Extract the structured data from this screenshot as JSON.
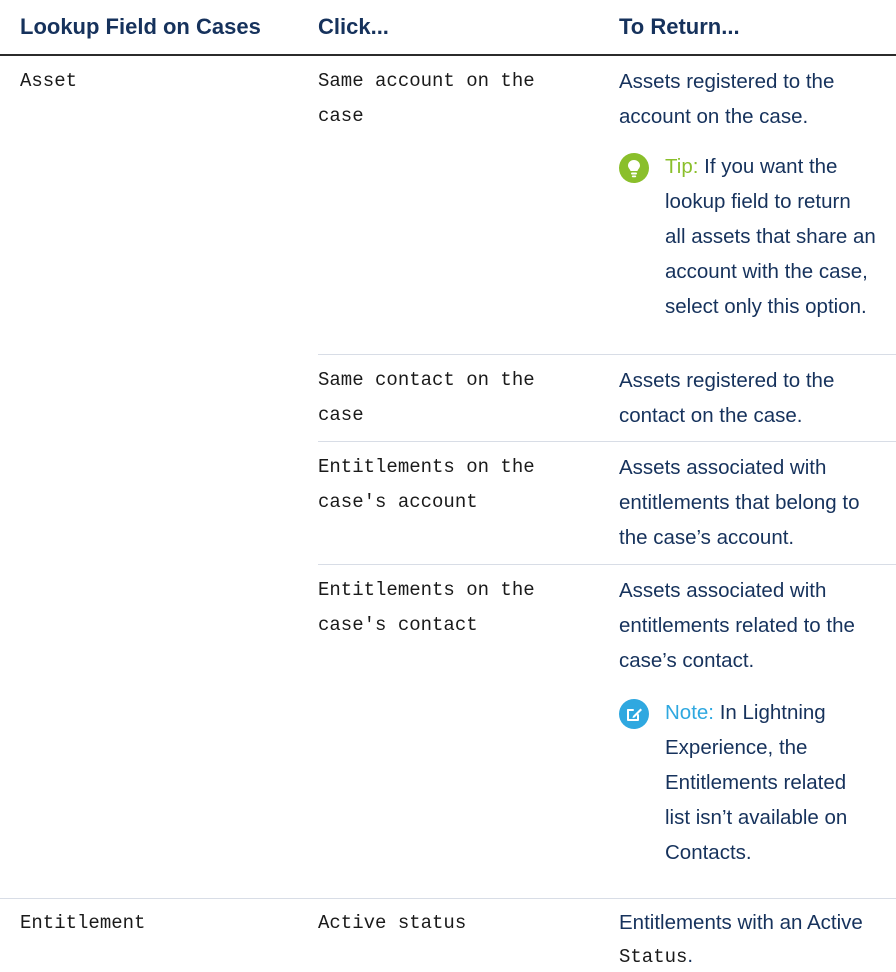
{
  "table": {
    "headers": {
      "lookup_field": "Lookup Field on Cases",
      "click": "Click...",
      "to_return": "To Return..."
    },
    "rows": [
      {
        "field": "Asset",
        "click": [
          "Same account on the",
          "case"
        ],
        "return": [
          "Assets registered to the",
          "account on the case."
        ],
        "tip": {
          "label": "Tip:",
          "lines": [
            "If you want the",
            "lookup field to return",
            "all assets that share an",
            "account with the case,",
            "select only this option."
          ]
        }
      },
      {
        "click": [
          "Same contact on the",
          "case"
        ],
        "return": [
          "Assets registered to the",
          "contact on the case."
        ]
      },
      {
        "click": [
          "Entitlements on the",
          "case's account"
        ],
        "return": [
          "Assets associated with",
          "entitlements that belong to",
          "the case’s account."
        ]
      },
      {
        "click": [
          "Entitlements on the",
          "case's contact"
        ],
        "return": [
          "Assets associated with",
          "entitlements related to the",
          "case’s contact."
        ],
        "note": {
          "label": "Note:",
          "lines": [
            "In Lightning",
            "Experience, the",
            "Entitlements related",
            "list isn’t available on",
            "Contacts."
          ]
        }
      },
      {
        "field": "Entitlement",
        "click": [
          "Active status"
        ],
        "return": [
          "Entitlements with an Active"
        ],
        "return_code": "Status",
        "return_tail": "."
      }
    ]
  },
  "colors": {
    "header_text": "#16325c",
    "tip_accent": "#8abf2b",
    "note_accent": "#2fa8e0",
    "divider": "#d8dde6"
  },
  "icons": {
    "tip": "lightbulb-icon",
    "note": "pencil-square-icon"
  }
}
